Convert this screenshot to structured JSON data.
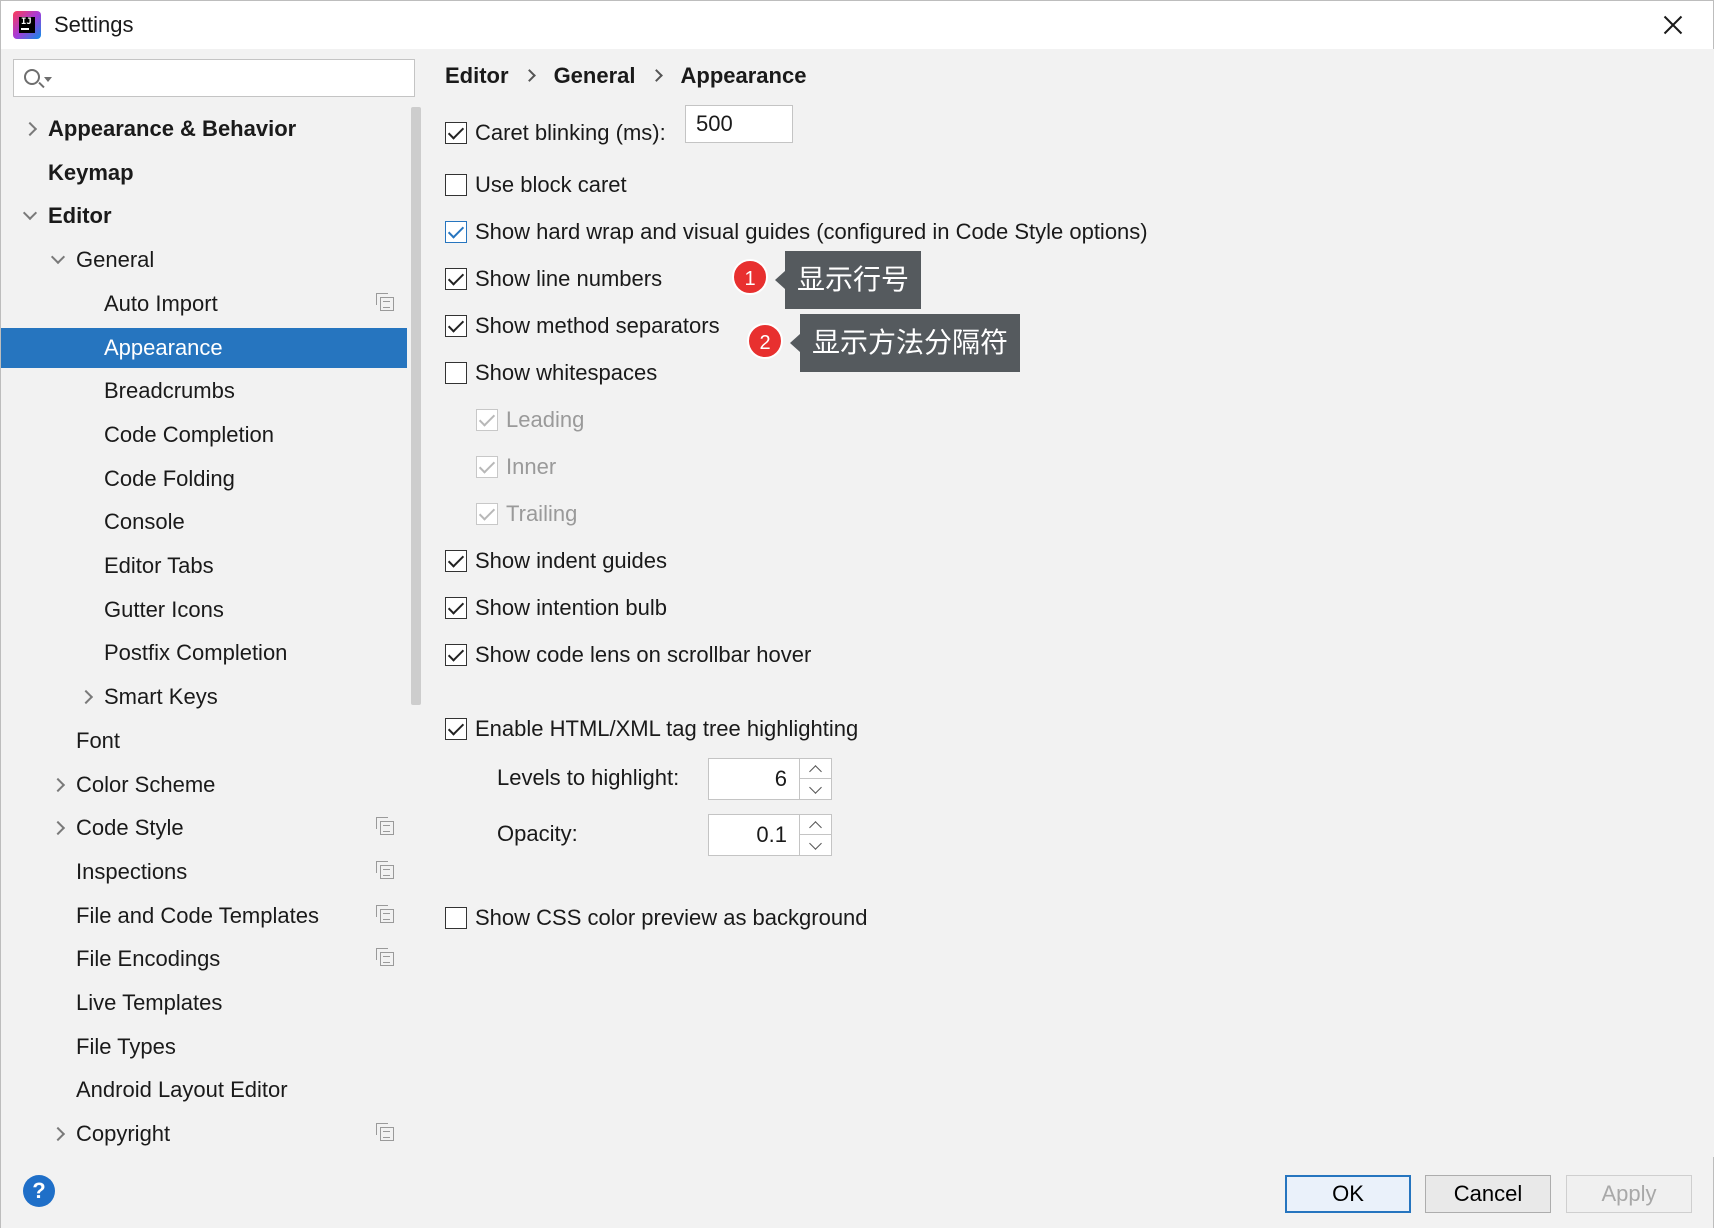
{
  "window": {
    "title": "Settings"
  },
  "search": {
    "value": "",
    "placeholder": ""
  },
  "sidebar": {
    "items": [
      {
        "label": "Appearance & Behavior",
        "level": 0,
        "arrow": "right",
        "bold": true,
        "icon": false,
        "selected": false
      },
      {
        "label": "Keymap",
        "level": 0,
        "arrow": "none",
        "bold": true,
        "icon": false,
        "selected": false
      },
      {
        "label": "Editor",
        "level": 0,
        "arrow": "down",
        "bold": true,
        "icon": false,
        "selected": false
      },
      {
        "label": "General",
        "level": 1,
        "arrow": "down",
        "bold": false,
        "icon": false,
        "selected": false
      },
      {
        "label": "Auto Import",
        "level": 2,
        "arrow": "none",
        "bold": false,
        "icon": true,
        "selected": false
      },
      {
        "label": "Appearance",
        "level": 2,
        "arrow": "none",
        "bold": false,
        "icon": false,
        "selected": true
      },
      {
        "label": "Breadcrumbs",
        "level": 2,
        "arrow": "none",
        "bold": false,
        "icon": false,
        "selected": false
      },
      {
        "label": "Code Completion",
        "level": 2,
        "arrow": "none",
        "bold": false,
        "icon": false,
        "selected": false
      },
      {
        "label": "Code Folding",
        "level": 2,
        "arrow": "none",
        "bold": false,
        "icon": false,
        "selected": false
      },
      {
        "label": "Console",
        "level": 2,
        "arrow": "none",
        "bold": false,
        "icon": false,
        "selected": false
      },
      {
        "label": "Editor Tabs",
        "level": 2,
        "arrow": "none",
        "bold": false,
        "icon": false,
        "selected": false
      },
      {
        "label": "Gutter Icons",
        "level": 2,
        "arrow": "none",
        "bold": false,
        "icon": false,
        "selected": false
      },
      {
        "label": "Postfix Completion",
        "level": 2,
        "arrow": "none",
        "bold": false,
        "icon": false,
        "selected": false
      },
      {
        "label": "Smart Keys",
        "level": 2,
        "arrow": "right",
        "bold": false,
        "icon": false,
        "selected": false
      },
      {
        "label": "Font",
        "level": 1,
        "arrow": "none",
        "bold": false,
        "icon": false,
        "selected": false
      },
      {
        "label": "Color Scheme",
        "level": 1,
        "arrow": "right",
        "bold": false,
        "icon": false,
        "selected": false
      },
      {
        "label": "Code Style",
        "level": 1,
        "arrow": "right",
        "bold": false,
        "icon": true,
        "selected": false
      },
      {
        "label": "Inspections",
        "level": 1,
        "arrow": "none",
        "bold": false,
        "icon": true,
        "selected": false
      },
      {
        "label": "File and Code Templates",
        "level": 1,
        "arrow": "none",
        "bold": false,
        "icon": true,
        "selected": false
      },
      {
        "label": "File Encodings",
        "level": 1,
        "arrow": "none",
        "bold": false,
        "icon": true,
        "selected": false
      },
      {
        "label": "Live Templates",
        "level": 1,
        "arrow": "none",
        "bold": false,
        "icon": false,
        "selected": false
      },
      {
        "label": "File Types",
        "level": 1,
        "arrow": "none",
        "bold": false,
        "icon": false,
        "selected": false
      },
      {
        "label": "Android Layout Editor",
        "level": 1,
        "arrow": "none",
        "bold": false,
        "icon": false,
        "selected": false
      },
      {
        "label": "Copyright",
        "level": 1,
        "arrow": "right",
        "bold": false,
        "icon": true,
        "selected": false
      }
    ]
  },
  "breadcrumb": [
    "Editor",
    "General",
    "Appearance"
  ],
  "options": {
    "caret_blinking": {
      "label": "Caret blinking (ms):",
      "checked": true,
      "value": "500"
    },
    "block_caret": {
      "label": "Use block caret",
      "checked": false
    },
    "hard_wrap": {
      "label": "Show hard wrap and visual guides (configured in Code Style options)",
      "checked": true
    },
    "line_numbers": {
      "label": "Show line numbers",
      "checked": true
    },
    "method_separators": {
      "label": "Show method separators",
      "checked": true
    },
    "whitespaces": {
      "label": "Show whitespaces",
      "checked": false
    },
    "leading": {
      "label": "Leading",
      "checked": true
    },
    "inner": {
      "label": "Inner",
      "checked": true
    },
    "trailing": {
      "label": "Trailing",
      "checked": true
    },
    "indent_guides": {
      "label": "Show indent guides",
      "checked": true
    },
    "intention_bulb": {
      "label": "Show intention bulb",
      "checked": true
    },
    "code_lens": {
      "label": "Show code lens on scrollbar hover",
      "checked": true
    },
    "tag_tree": {
      "label": "Enable HTML/XML tag tree highlighting",
      "checked": true
    },
    "levels": {
      "label": "Levels to highlight:",
      "value": "6"
    },
    "opacity": {
      "label": "Opacity:",
      "value": "0.1"
    },
    "css_preview": {
      "label": "Show CSS color preview as background",
      "checked": false
    }
  },
  "annotations": [
    {
      "number": "1",
      "text": "显示行号"
    },
    {
      "number": "2",
      "text": "显示方法分隔符"
    }
  ],
  "footer": {
    "help": "?",
    "ok": "OK",
    "cancel": "Cancel",
    "apply": "Apply"
  },
  "colors": {
    "selection": "#2675bf",
    "badge": "#e8302f",
    "tooltip": "#555a5e"
  }
}
